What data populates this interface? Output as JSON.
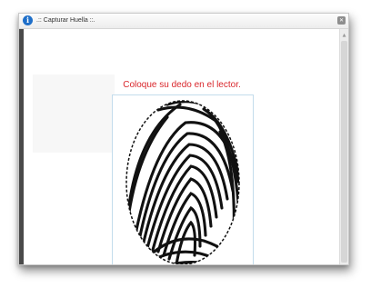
{
  "window": {
    "title": ".:: Capturar Huella ::.",
    "title_icon": "info-icon",
    "close_icon": "close-icon"
  },
  "content": {
    "instruction": "Coloque su dedo en el lector.",
    "instruction_color": "#d9262b",
    "image": "fingerprint-image"
  }
}
